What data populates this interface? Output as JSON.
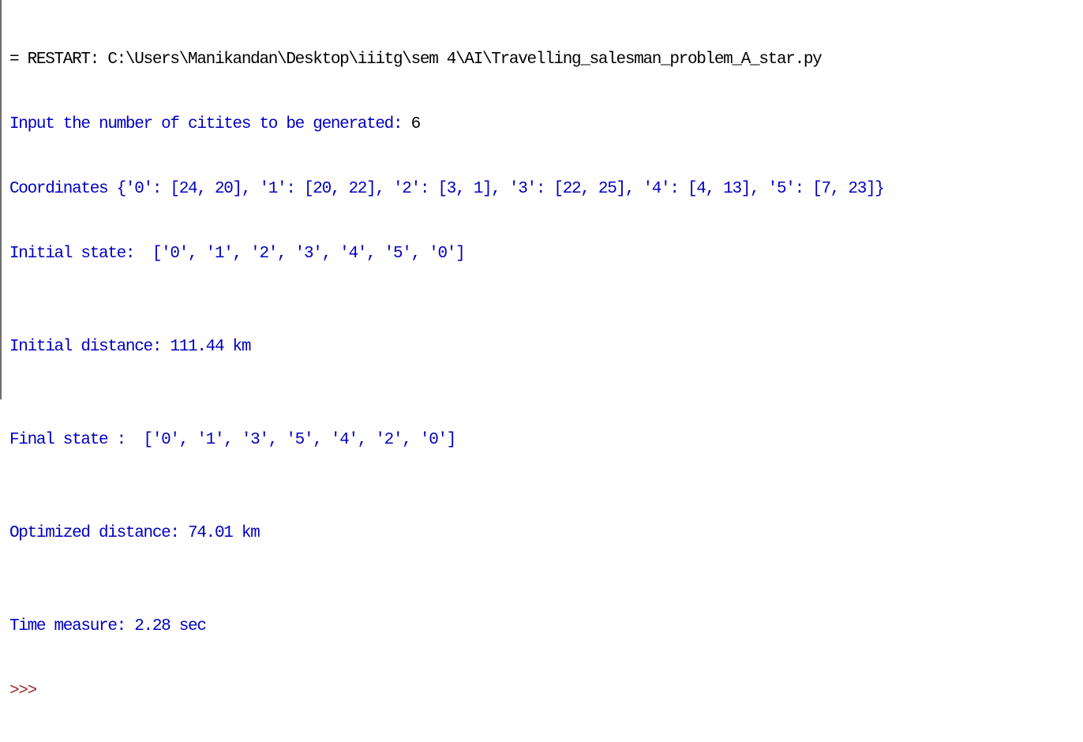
{
  "shell": {
    "restart_line": "= RESTART: C:\\Users\\Manikandan\\Desktop\\iiitg\\sem 4\\AI\\Travelling_salesman_problem_A_star.py",
    "input_prompt": "Input the number of citites to be generated: ",
    "input_value": "6",
    "coordinates_line": "Coordinates {'0': [24, 20], '1': [20, 22], '2': [3, 1], '3': [22, 25], '4': [4, 13], '5': [7, 23]}",
    "initial_state_line": "Initial state:  ['0', '1', '2', '3', '4', '5', '0']",
    "initial_distance_line": "Initial distance: 111.44 km",
    "final_state_line": "Final state :  ['0', '1', '3', '5', '4', '2', '0']",
    "optimized_distance_line": "Optimized distance: 74.01 km",
    "time_measure_line": "Time measure: 2.28 sec",
    "prompt": ">>>"
  },
  "colors": {
    "output_text": "#0000c0",
    "restart_text": "#000000",
    "prompt_text": "#9a2a2a",
    "background": "#ffffff"
  }
}
